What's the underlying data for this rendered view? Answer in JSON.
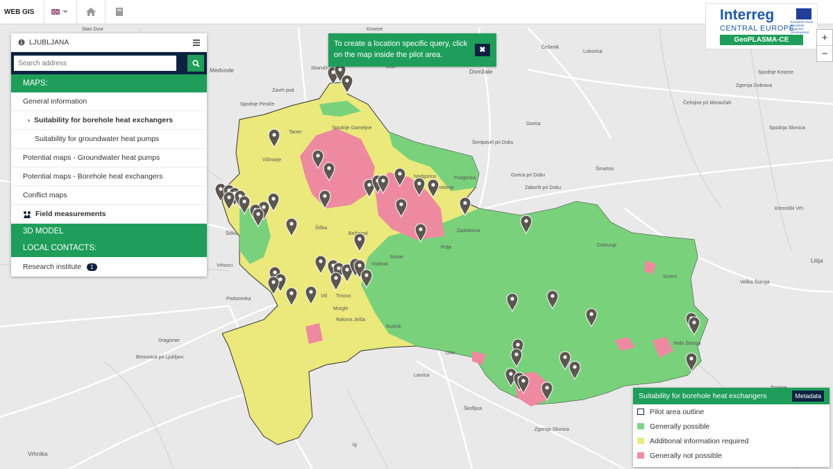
{
  "topbar": {
    "brand": "WEB GIS",
    "flag_icon": "uk-flag-icon",
    "home_icon": "home-icon",
    "book_icon": "book-icon"
  },
  "panel": {
    "city": "LJUBLJANA",
    "search_placeholder": "Search address",
    "maps_header": "MAPS:",
    "items": [
      {
        "label": "General information"
      },
      {
        "label": "Suitability for borehole heat exchangers"
      },
      {
        "label": "Suitability for groundwater heat pumps"
      },
      {
        "label": "Potential maps - Groundwater heat pumps"
      },
      {
        "label": "Potential maps - Borehole heat exchangers"
      },
      {
        "label": "Conflict maps"
      },
      {
        "label": "Field measurements"
      }
    ],
    "model_header": "3D MODEL",
    "contacts_header": "LOCAL CONTACTS:",
    "research": {
      "label": "Research institute",
      "count": "1"
    }
  },
  "tooltip": {
    "text": "To create a location specific query, click on the map inside the pilot area.",
    "close": "✖"
  },
  "logo": {
    "interreg": "Interreg",
    "region": "CENTRAL EUROPE",
    "project": "GeoPLASMA-CE",
    "eu_text": "European Union European Regional Development Fund"
  },
  "zoom": {
    "plus": "+",
    "minus": "−"
  },
  "legend": {
    "title": "Suitability for borehole heat exchangers",
    "metadata": "Metadata",
    "items": [
      {
        "label": "Pilot area outline",
        "color": "#ffffff",
        "border": "#0d2240"
      },
      {
        "label": "Generally possible",
        "color": "#7ed68a",
        "border": "#7ed68a"
      },
      {
        "label": "Additional information required",
        "color": "#eaea80",
        "border": "#eaea80"
      },
      {
        "label": "Generally not possible",
        "color": "#ef8ea0",
        "border": "#ef8ea0"
      }
    ]
  },
  "colors": {
    "accent": "#1e9e5a",
    "navy": "#0d2240",
    "yellow": "#ebe87c",
    "green": "#79d17c",
    "pink": "#ee8aa0"
  },
  "map_labels": [
    "Stari Dvor",
    "Koseze",
    "Češenik",
    "Spodnje Koseze",
    "Medvode",
    "Skaručna",
    "Zgornja Dobrava",
    "Domžale",
    "Dob",
    "Zavrh pod",
    "Spodnje Pirniče",
    "Spodnje Gameljne",
    "Gorica",
    "Šentpavel pri Dobu",
    "Šmartno",
    "Nadgorica",
    "Zaboršt pri Dobu",
    "Spodnja Slivnica",
    "Gorica pri Dobu",
    "Sneberje",
    "Tacen",
    "Vižmarje",
    "Dobrunje",
    "Šiška",
    "Bežigrad",
    "Podgorica",
    "Kresniški Vrh",
    "Polje",
    "Zadobrova",
    "Vodmat",
    "Sostro",
    "Moste",
    "Šiška",
    "Vrhovci",
    "Vič",
    "Trnovo",
    "Murgle",
    "Rakova Jelša",
    "Rudnik",
    "Podsmreka",
    "Dragomer",
    "Brezovica pri Ljubljani",
    "Lavrica",
    "Orle",
    "Vrhnika",
    "Ig",
    "Škofljica",
    "Zgornja Slivnica",
    "Litija",
    "Mala Štanga",
    "Velika Štanga",
    "Češnjice pri Moravčah",
    "Lukovica",
    "Trojane"
  ]
}
